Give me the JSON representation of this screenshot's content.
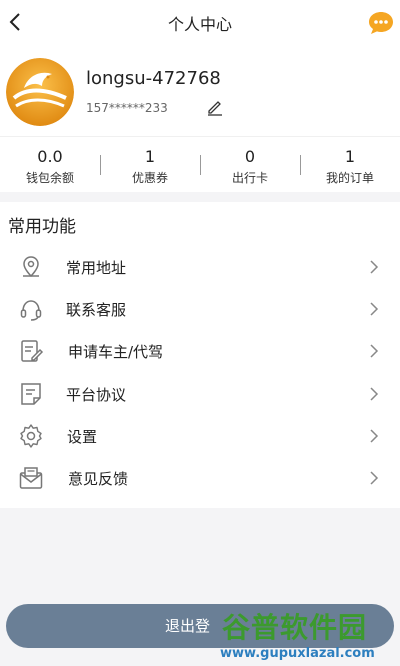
{
  "header": {
    "title": "个人中心",
    "back_icon": "chevron-left-icon",
    "chat_icon": "chat-bubble-icon",
    "chat_color": "#f5a623"
  },
  "profile": {
    "username": "longsu-472768",
    "phone": "157******233",
    "edit_icon": "pencil-icon"
  },
  "stats": [
    {
      "value": "0.0",
      "label": "钱包余额"
    },
    {
      "value": "1",
      "label": "优惠券"
    },
    {
      "value": "0",
      "label": "出行卡"
    },
    {
      "value": "1",
      "label": "我的订单"
    }
  ],
  "functions": {
    "title": "常用功能",
    "items": [
      {
        "label": "常用地址",
        "icon": "location-pin-icon"
      },
      {
        "label": "联系客服",
        "icon": "headset-icon"
      },
      {
        "label": "申请车主/代驾",
        "icon": "edit-document-icon"
      },
      {
        "label": "平台协议",
        "icon": "document-icon"
      },
      {
        "label": "设置",
        "icon": "gear-icon"
      },
      {
        "label": "意见反馈",
        "icon": "feedback-envelope-icon"
      }
    ]
  },
  "logout": {
    "label": "退出登"
  },
  "watermark": {
    "title": "谷普软件园",
    "url": "www.gupuxlazal.com"
  }
}
